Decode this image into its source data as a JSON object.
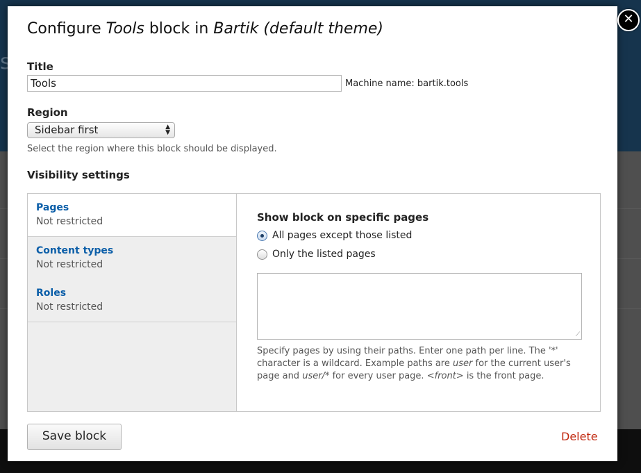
{
  "dialog": {
    "title_prefix": "Configure ",
    "title_block": "Tools",
    "title_middle": " block in ",
    "title_theme": "Bartik (default theme)"
  },
  "background": {
    "partial_text": "st"
  },
  "close_button": {
    "icon": "close-icon",
    "glyph": "✕"
  },
  "title_field": {
    "label": "Title",
    "value": "Tools",
    "machine_name": "Machine name: bartik.tools"
  },
  "region_field": {
    "label": "Region",
    "selected": "Sidebar first",
    "help": "Select the region where this block should be displayed."
  },
  "visibility": {
    "label": "Visibility settings",
    "tabs": [
      {
        "title": "Pages",
        "summary": "Not restricted"
      },
      {
        "title": "Content types",
        "summary": "Not restricted"
      },
      {
        "title": "Roles",
        "summary": "Not restricted"
      }
    ],
    "pages_pane": {
      "heading": "Show block on specific pages",
      "options": [
        {
          "label": "All pages except those listed",
          "checked": true
        },
        {
          "label": "Only the listed pages",
          "checked": false
        }
      ],
      "pages_value": "",
      "help_1": "Specify pages by using their paths. Enter one path per line. The '*' character is a wildcard. Example paths are ",
      "help_user": "user",
      "help_2": " for the current user's page and ",
      "help_user_star": "user/*",
      "help_3": " for every user page. ",
      "help_front": "<front>",
      "help_4": " is the front page."
    }
  },
  "actions": {
    "save_label": "Save block",
    "delete_label": "Delete"
  },
  "colors": {
    "link": "#0b5ea8",
    "delete": "#c1270e",
    "overlay_header": "#16344d"
  }
}
